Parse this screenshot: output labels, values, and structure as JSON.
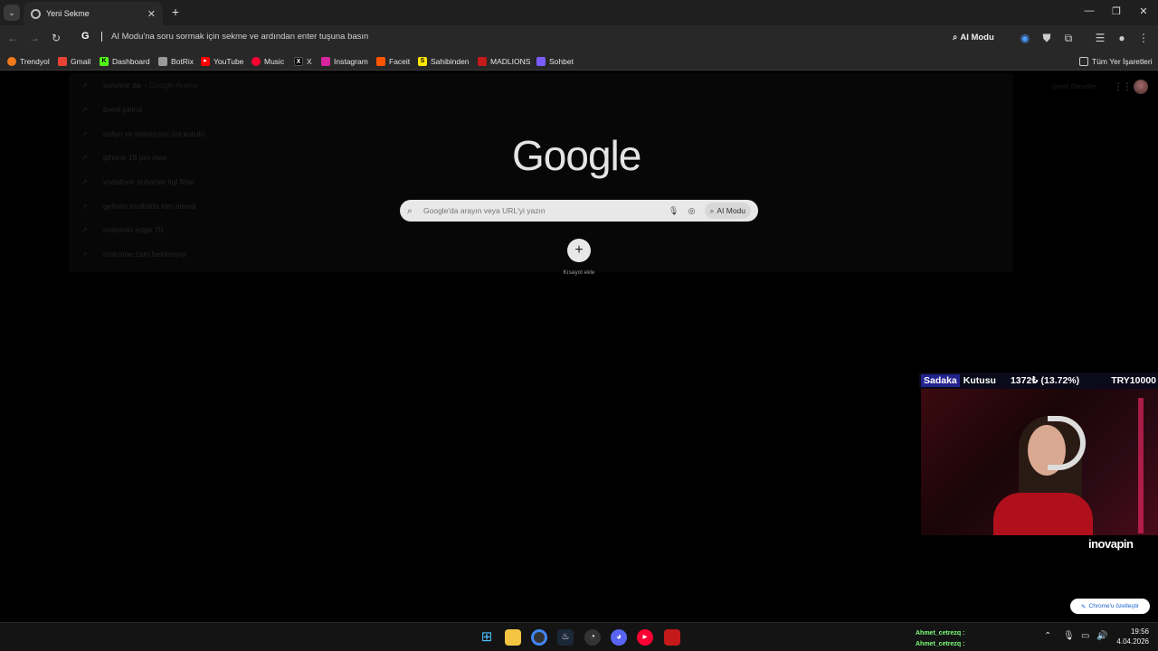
{
  "browser": {
    "tab": {
      "title": "Yeni Sekme",
      "close": "✕"
    },
    "new_tab": "+",
    "window_controls": {
      "minimize": "—",
      "maximize": "❐",
      "close": "✕"
    },
    "omnibox": {
      "logo": "G",
      "text": "AI Modu'na soru sormak için sekme ve ardından enter tuşuna basın"
    },
    "ai_mode": "AI Modu",
    "bookmarks": [
      {
        "label": "Trendyol",
        "icon": "trendyol-icon",
        "color": "#f27a1a"
      },
      {
        "label": "Gmail",
        "icon": "gmail-icon",
        "color": "#ea4335"
      },
      {
        "label": "Dashboard",
        "icon": "dashboard-icon",
        "color": "#53fc18"
      },
      {
        "label": "BotRix",
        "icon": "botrix-icon",
        "color": "#9a9a9a"
      },
      {
        "label": "YouTube",
        "icon": "youtube-icon",
        "color": "#ff0000"
      },
      {
        "label": "Music",
        "icon": "music-icon",
        "color": "#ff0033"
      },
      {
        "label": "X",
        "icon": "x-icon",
        "color": "#000000"
      },
      {
        "label": "Instagram",
        "icon": "instagram-icon",
        "color": "#d6249f"
      },
      {
        "label": "Faceit",
        "icon": "faceit-icon",
        "color": "#ff5500"
      },
      {
        "label": "Sahibinden",
        "icon": "sahibinden-icon",
        "color": "#ffe800"
      },
      {
        "label": "MADLIONS",
        "icon": "madlions-icon",
        "color": "#c41a1a"
      },
      {
        "label": "Sohbet",
        "icon": "sohbet-icon",
        "color": "#7b5cff"
      }
    ],
    "all_bookmarks": "Tüm Yer İşaretleri"
  },
  "newtab": {
    "suggestions": [
      {
        "text": "survivor da",
        "sub": "- Google Arama"
      },
      {
        "text": "brent petrol",
        "sub": ""
      },
      {
        "text": "radyo ve televizyon üst kurulu",
        "sub": ""
      },
      {
        "text": "iphone 18 pro max",
        "sub": ""
      },
      {
        "text": "vodafone sultanlar ligi final",
        "sub": ""
      },
      {
        "text": "gelinim mutfakta kim elendi",
        "sub": ""
      },
      {
        "text": "motorola edge 70",
        "sub": ""
      },
      {
        "text": "motorine zam bekleniyor",
        "sub": ""
      }
    ],
    "top_links": "Gmail   Görseller",
    "logo": "Google",
    "search_placeholder": "Google'da arayın veya URL'yi yazın",
    "ai_mode": "AI Modu",
    "add_shortcut": "+",
    "add_shortcut_label": "Kısayol ekle",
    "customize": "Chrome'u özelleştir"
  },
  "overlay": {
    "donate_title_a": "Sadaka",
    "donate_title_b": "Kutusu",
    "donate_amount": "1372₺ (13.72%)",
    "donate_goal": "TRY10000",
    "sponsor": "inovapin"
  },
  "taskbar": {
    "chat": [
      {
        "name": "Ahmet_cetrezq :"
      },
      {
        "name": "Ahmet_cetrezq :"
      }
    ],
    "time": "19:56",
    "date": "4.04.2026"
  }
}
